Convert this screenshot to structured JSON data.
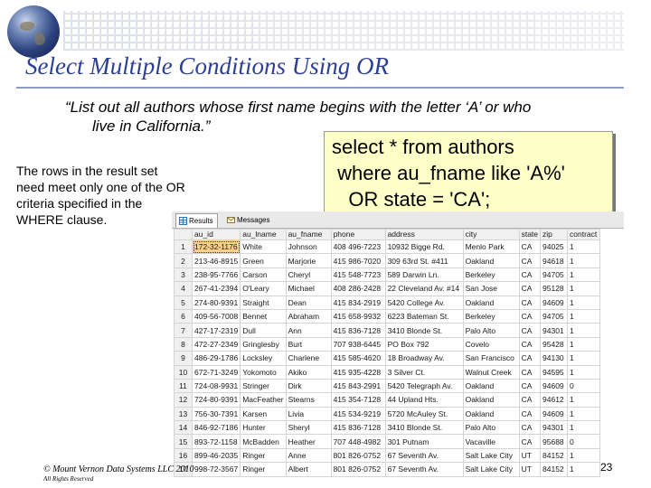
{
  "logo": {
    "icon": "globe-icon"
  },
  "slide": {
    "title": "Select Multiple Conditions Using OR",
    "quote_line1": "“List out all authors whose first name begins with the letter ‘A’ or who",
    "quote_line2": "live in California.”",
    "note": "The rows in the result set need meet only one of the OR criteria specified in the WHERE clause.",
    "footer_copyright": "© Mount Vernon Data Systems LLC 2010",
    "footer_rights": "All Rights Reserved",
    "page_number": "23"
  },
  "sql": {
    "line1": "select * from authors",
    "line2": " where au_fname like 'A%'",
    "line3": "   OR state = 'CA';"
  },
  "results": {
    "tabs": [
      {
        "label": "Results",
        "icon": "grid-icon",
        "active": true
      },
      {
        "label": "Messages",
        "icon": "message-icon",
        "active": false
      }
    ],
    "columns": [
      "",
      "au_id",
      "au_lname",
      "au_fname",
      "phone",
      "address",
      "city",
      "state",
      "zip",
      "contract"
    ],
    "rows": [
      [
        "1",
        "172-32-1176",
        "White",
        "Johnson",
        "408 496-7223",
        "10932 Bigge Rd.",
        "Menlo Park",
        "CA",
        "94025",
        "1"
      ],
      [
        "2",
        "213-46-8915",
        "Green",
        "Marjorie",
        "415 986-7020",
        "309 63rd St. #411",
        "Oakland",
        "CA",
        "94618",
        "1"
      ],
      [
        "3",
        "238-95-7766",
        "Carson",
        "Cheryl",
        "415 548-7723",
        "589 Darwin Ln.",
        "Berkeley",
        "CA",
        "94705",
        "1"
      ],
      [
        "4",
        "267-41-2394",
        "O'Leary",
        "Michael",
        "408 286-2428",
        "22 Cleveland Av. #14",
        "San Jose",
        "CA",
        "95128",
        "1"
      ],
      [
        "5",
        "274-80-9391",
        "Straight",
        "Dean",
        "415 834-2919",
        "5420 College Av.",
        "Oakland",
        "CA",
        "94609",
        "1"
      ],
      [
        "6",
        "409-56-7008",
        "Bennet",
        "Abraham",
        "415 658-9932",
        "6223 Bateman St.",
        "Berkeley",
        "CA",
        "94705",
        "1"
      ],
      [
        "7",
        "427-17-2319",
        "Dull",
        "Ann",
        "415 836-7128",
        "3410 Blonde St.",
        "Palo Alto",
        "CA",
        "94301",
        "1"
      ],
      [
        "8",
        "472-27-2349",
        "Gringlesby",
        "Burt",
        "707 938-6445",
        "PO Box 792",
        "Covelo",
        "CA",
        "95428",
        "1"
      ],
      [
        "9",
        "486-29-1786",
        "Locksley",
        "Charlene",
        "415 585-4620",
        "18 Broadway Av.",
        "San Francisco",
        "CA",
        "94130",
        "1"
      ],
      [
        "10",
        "672-71-3249",
        "Yokomoto",
        "Akiko",
        "415 935-4228",
        "3 Silver Ct.",
        "Walnut Creek",
        "CA",
        "94595",
        "1"
      ],
      [
        "11",
        "724-08-9931",
        "Stringer",
        "Dirk",
        "415 843-2991",
        "5420 Telegraph Av.",
        "Oakland",
        "CA",
        "94609",
        "0"
      ],
      [
        "12",
        "724-80-9391",
        "MacFeather",
        "Stearns",
        "415 354-7128",
        "44 Upland Hts.",
        "Oakland",
        "CA",
        "94612",
        "1"
      ],
      [
        "13",
        "756-30-7391",
        "Karsen",
        "Livia",
        "415 534-9219",
        "5720 McAuley St.",
        "Oakland",
        "CA",
        "94609",
        "1"
      ],
      [
        "14",
        "846-92-7186",
        "Hunter",
        "Sheryl",
        "415 836-7128",
        "3410 Blonde St.",
        "Palo Alto",
        "CA",
        "94301",
        "1"
      ],
      [
        "15",
        "893-72-1158",
        "McBadden",
        "Heather",
        "707 448-4982",
        "301 Putnam",
        "Vacaville",
        "CA",
        "95688",
        "0"
      ],
      [
        "16",
        "899-46-2035",
        "Ringer",
        "Anne",
        "801 826-0752",
        "67 Seventh Av.",
        "Salt Lake City",
        "UT",
        "84152",
        "1"
      ],
      [
        "17",
        "998-72-3567",
        "Ringer",
        "Albert",
        "801 826-0752",
        "67 Seventh Av.",
        "Salt Lake City",
        "UT",
        "84152",
        "1"
      ]
    ]
  }
}
